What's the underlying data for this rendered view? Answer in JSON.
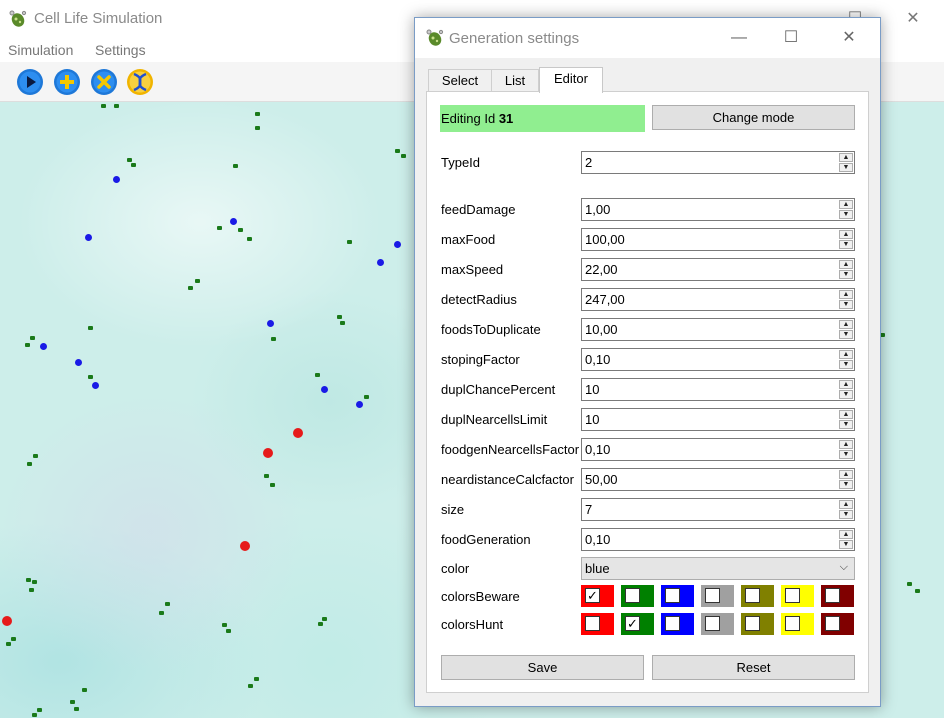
{
  "main": {
    "title": "Cell Life Simulation",
    "menu": [
      "Simulation",
      "Settings"
    ],
    "toolbar": [
      {
        "icon": "play-icon",
        "color": "#1e78d8"
      },
      {
        "icon": "add-icon",
        "color": "#1e78d8"
      },
      {
        "icon": "remove-icon",
        "color": "#1e78d8"
      },
      {
        "icon": "dna-icon",
        "color": "#f0b400"
      }
    ],
    "window_controls": [
      "—",
      "☐",
      "✕"
    ]
  },
  "canvas": {
    "cell_colors": {
      "blue": "#1a1ae6",
      "red": "#e61a1a",
      "food": "#1a7a1a"
    }
  },
  "dialog": {
    "title": "Generation settings",
    "window_controls": [
      "—",
      "☐",
      "✕"
    ],
    "tabs": [
      "Select",
      "List",
      "Editor"
    ],
    "active_tab": "Editor",
    "editing_label": "Editing Id",
    "editing_id": "31",
    "change_mode": "Change mode",
    "typeid": {
      "label": "TypeId",
      "value": "2"
    },
    "fields": [
      {
        "label": "feedDamage",
        "value": "1,00"
      },
      {
        "label": "maxFood",
        "value": "100,00"
      },
      {
        "label": "maxSpeed",
        "value": "22,00"
      },
      {
        "label": "detectRadius",
        "value": "247,00"
      },
      {
        "label": "foodsToDuplicate",
        "value": "10,00"
      },
      {
        "label": "stopingFactor",
        "value": "0,10"
      },
      {
        "label": "duplChancePercent",
        "value": "10"
      },
      {
        "label": "duplNearcellsLimit",
        "value": "10"
      },
      {
        "label": "foodgenNearcellsFactor",
        "value": "0,10"
      },
      {
        "label": "neardistanceCalcfactor",
        "value": "50,00"
      },
      {
        "label": "size",
        "value": "7"
      },
      {
        "label": "foodGeneration",
        "value": "0,10"
      }
    ],
    "color": {
      "label": "color",
      "value": "blue"
    },
    "swatch_colors": [
      "#ff0000",
      "#008000",
      "#0000ff",
      "#a0a0a0",
      "#808000",
      "#ffff00",
      "#800000"
    ],
    "colorsBeware": {
      "label": "colorsBeware",
      "checked": [
        true,
        false,
        false,
        false,
        false,
        false,
        false
      ]
    },
    "colorsHunt": {
      "label": "colorsHunt",
      "checked": [
        false,
        true,
        false,
        false,
        false,
        false,
        false
      ]
    },
    "save": "Save",
    "reset": "Reset"
  }
}
